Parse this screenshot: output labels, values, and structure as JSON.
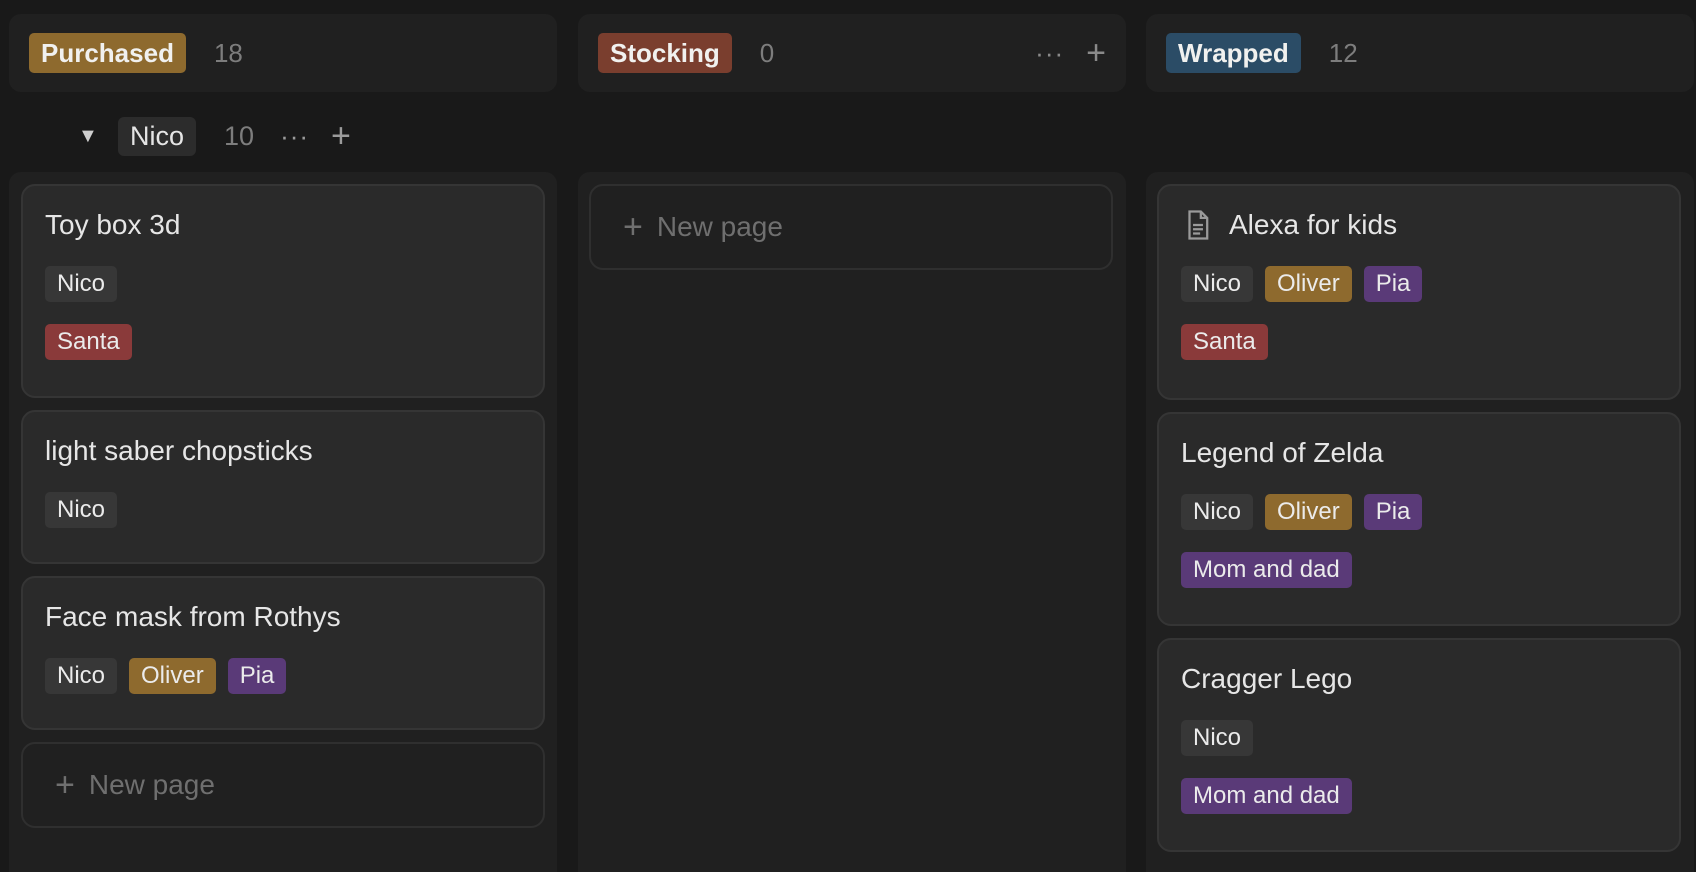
{
  "columns": [
    {
      "status": "Purchased",
      "count": "18",
      "color": "#8e6a2e"
    },
    {
      "status": "Stocking",
      "count": "0",
      "color": "#7a3e2e"
    },
    {
      "status": "Wrapped",
      "count": "12",
      "color": "#2b4c66"
    }
  ],
  "header_actions": {
    "more": "···",
    "add": "+"
  },
  "group": {
    "caret": "▼",
    "name": "Nico",
    "count": "10",
    "more": "···",
    "add": "+"
  },
  "tag_colors": {
    "Nico": "#373737",
    "Oliver": "#8e6a2e",
    "Pia": "#5a3a78",
    "Santa": "#8a3a3a",
    "Mom and dad": "#5a3a78"
  },
  "purchased_cards": [
    {
      "title": "Toy box 3d",
      "people": [
        "Nico"
      ],
      "from": [
        "Santa"
      ]
    },
    {
      "title": "light saber chopsticks",
      "people": [
        "Nico"
      ],
      "from": []
    },
    {
      "title": "Face mask from Rothys",
      "people": [
        "Nico",
        "Oliver",
        "Pia"
      ],
      "from": []
    }
  ],
  "wrapped_cards": [
    {
      "title": "Alexa for kids",
      "icon": "document-icon",
      "people": [
        "Nico",
        "Oliver",
        "Pia"
      ],
      "from": [
        "Santa"
      ]
    },
    {
      "title": "Legend of Zelda",
      "people": [
        "Nico",
        "Oliver",
        "Pia"
      ],
      "from": [
        "Mom and dad"
      ]
    },
    {
      "title": "Cragger Lego",
      "people": [
        "Nico"
      ],
      "from": [
        "Mom and dad"
      ]
    }
  ],
  "new_page_label": "New page",
  "new_page_plus": "+"
}
